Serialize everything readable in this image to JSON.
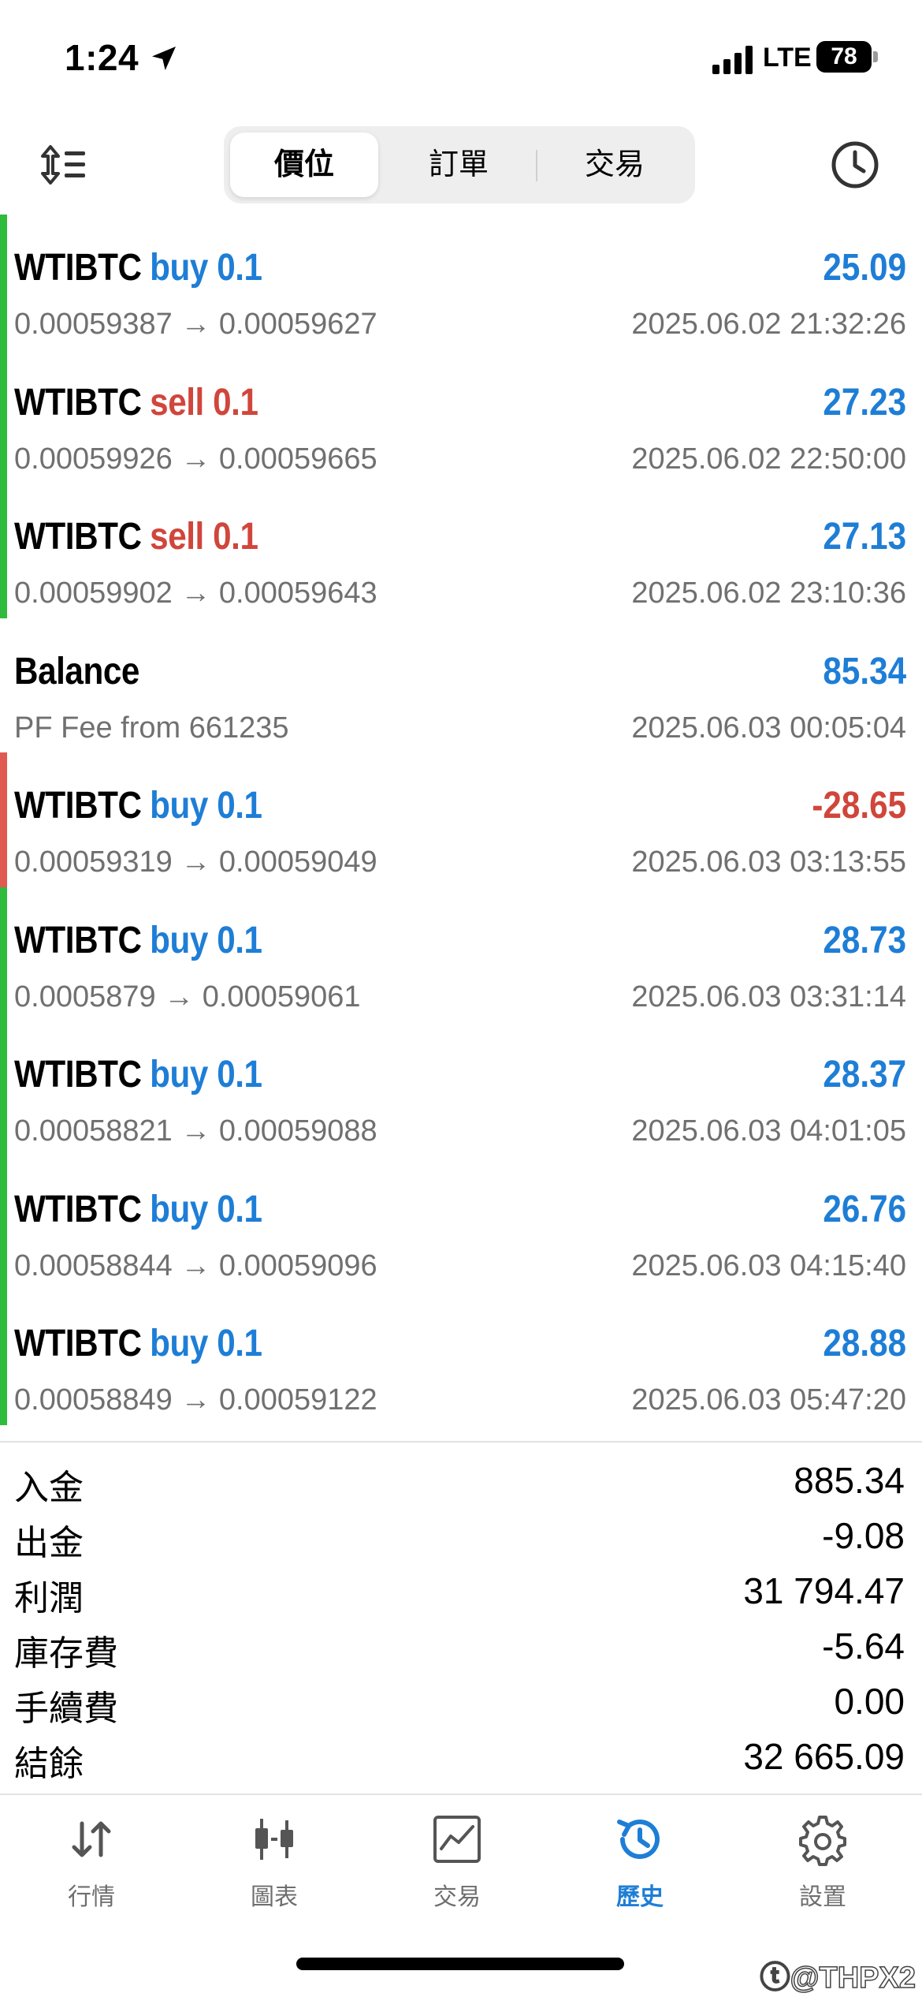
{
  "status_bar": {
    "time": "1:24",
    "network": "LTE",
    "battery": "78"
  },
  "tabs_segment": [
    {
      "label": "價位",
      "active": true
    },
    {
      "label": "訂單",
      "active": false
    },
    {
      "label": "交易",
      "active": false
    }
  ],
  "positions": [
    {
      "symbol": "WTIBTC",
      "side": "buy 0.1",
      "side_color": "blue",
      "pl": "25.09",
      "pl_color": "blue",
      "prices": "0.00059387 → 0.00059627",
      "time": "2025.06.02 21:32:26",
      "bar": "green"
    },
    {
      "symbol": "WTIBTC",
      "side": "sell 0.1",
      "side_color": "red",
      "pl": "27.23",
      "pl_color": "blue",
      "prices": "0.00059926 → 0.00059665",
      "time": "2025.06.02 22:50:00",
      "bar": "green"
    },
    {
      "symbol": "WTIBTC",
      "side": "sell 0.1",
      "side_color": "red",
      "pl": "27.13",
      "pl_color": "blue",
      "prices": "0.00059902 → 0.00059643",
      "time": "2025.06.02 23:10:36",
      "bar": "green"
    },
    {
      "symbol": "Balance",
      "side": "",
      "side_color": "blue",
      "pl": "85.34",
      "pl_color": "blue",
      "prices": "PF Fee from 661235",
      "time": "2025.06.03 00:05:04",
      "bar": "none"
    },
    {
      "symbol": "WTIBTC",
      "side": "buy 0.1",
      "side_color": "blue",
      "pl": "-28.65",
      "pl_color": "red",
      "prices": "0.00059319 → 0.00059049",
      "time": "2025.06.03 03:13:55",
      "bar": "red"
    },
    {
      "symbol": "WTIBTC",
      "side": "buy 0.1",
      "side_color": "blue",
      "pl": "28.73",
      "pl_color": "blue",
      "prices": "0.0005879 → 0.00059061",
      "time": "2025.06.03 03:31:14",
      "bar": "green"
    },
    {
      "symbol": "WTIBTC",
      "side": "buy 0.1",
      "side_color": "blue",
      "pl": "28.37",
      "pl_color": "blue",
      "prices": "0.00058821 → 0.00059088",
      "time": "2025.06.03 04:01:05",
      "bar": "green"
    },
    {
      "symbol": "WTIBTC",
      "side": "buy 0.1",
      "side_color": "blue",
      "pl": "26.76",
      "pl_color": "blue",
      "prices": "0.00058844 → 0.00059096",
      "time": "2025.06.03 04:15:40",
      "bar": "green"
    },
    {
      "symbol": "WTIBTC",
      "side": "buy 0.1",
      "side_color": "blue",
      "pl": "28.88",
      "pl_color": "blue",
      "prices": "0.00058849 → 0.00059122",
      "time": "2025.06.03 05:47:20",
      "bar": "green"
    }
  ],
  "summary": [
    {
      "label": "入金",
      "value": "885.34"
    },
    {
      "label": "出金",
      "value": "-9.08"
    },
    {
      "label": "利潤",
      "value": "31 794.47"
    },
    {
      "label": "庫存費",
      "value": "-5.64"
    },
    {
      "label": "手續費",
      "value": "0.00"
    },
    {
      "label": "結餘",
      "value": "32 665.09"
    }
  ],
  "tabbar": [
    {
      "label": "行情",
      "icon": "quotes-icon",
      "active": false
    },
    {
      "label": "圖表",
      "icon": "chart-icon",
      "active": false
    },
    {
      "label": "交易",
      "icon": "trade-icon",
      "active": false
    },
    {
      "label": "歷史",
      "icon": "history-icon",
      "active": true
    },
    {
      "label": "設置",
      "icon": "settings-icon",
      "active": false
    }
  ],
  "watermark": "ⓣ@THPX2",
  "colors": {
    "blue": "#1e7ed6",
    "red": "#d0463b",
    "green": "#2fbb3b",
    "gray_text": "#707070"
  }
}
